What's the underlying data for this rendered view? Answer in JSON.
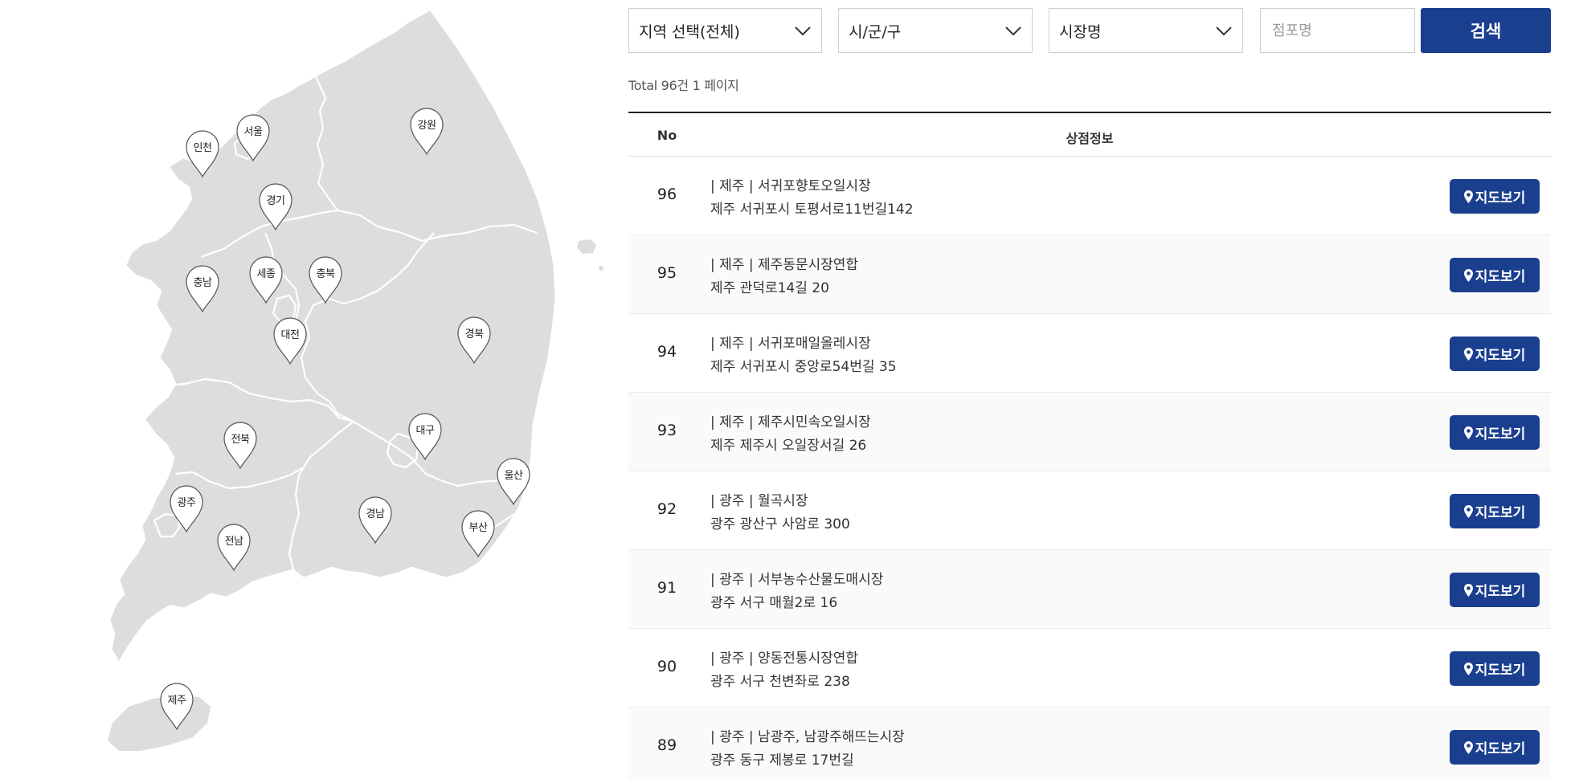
{
  "map": {
    "regions": [
      {
        "label": "인천"
      },
      {
        "label": "서울"
      },
      {
        "label": "강원"
      },
      {
        "label": "경기"
      },
      {
        "label": "충남"
      },
      {
        "label": "세종"
      },
      {
        "label": "충북"
      },
      {
        "label": "대전"
      },
      {
        "label": "경북"
      },
      {
        "label": "전북"
      },
      {
        "label": "대구"
      },
      {
        "label": "울산"
      },
      {
        "label": "광주"
      },
      {
        "label": "경남"
      },
      {
        "label": "부산"
      },
      {
        "label": "전남"
      },
      {
        "label": "제주"
      }
    ]
  },
  "search": {
    "region_select": "지역 선택(전체)",
    "district_select": "시/군/구",
    "market_select": "시장명",
    "store_placeholder": "점포명",
    "search_button": "검색"
  },
  "total_text": "Total 96건 1 페이지",
  "table": {
    "headers": {
      "no": "No",
      "info": "상점정보"
    },
    "map_button_label": "지도보기",
    "rows": [
      {
        "no": "96",
        "line1": "| 제주 | 서귀포향토오일시장",
        "line2": "제주 서귀포시 토평서로11번길142"
      },
      {
        "no": "95",
        "line1": "| 제주 | 제주동문시장연합",
        "line2": "제주 관덕로14길 20"
      },
      {
        "no": "94",
        "line1": "| 제주 | 서귀포매일올레시장",
        "line2": "제주 서귀포시 중앙로54번길 35"
      },
      {
        "no": "93",
        "line1": "| 제주 | 제주시민속오일시장",
        "line2": "제주 제주시 오일장서길 26"
      },
      {
        "no": "92",
        "line1": "| 광주 | 월곡시장",
        "line2": "광주 광산구 사암로 300"
      },
      {
        "no": "91",
        "line1": "| 광주 | 서부농수산물도매시장",
        "line2": "광주 서구 매월2로 16"
      },
      {
        "no": "90",
        "line1": "| 광주 | 양동전통시장연합",
        "line2": "광주 서구 천변좌로 238"
      },
      {
        "no": "89",
        "line1": "| 광주 | 남광주, 남광주해뜨는시장",
        "line2": "광주 동구 제봉로 17번길"
      }
    ]
  },
  "colors": {
    "accent": "#1b3f8f",
    "map_fill": "#dddddd",
    "map_border": "#ffffff"
  }
}
